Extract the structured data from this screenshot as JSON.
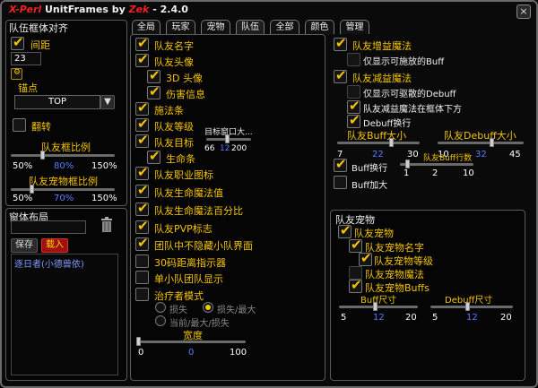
{
  "title": {
    "brand": "X-Perl",
    "rest": " UnitFrames by ",
    "author": "Zek",
    "version": " - 2.4.0"
  },
  "close_label": "×",
  "tabs": [
    "全局",
    "玩家",
    "宠物",
    "队伍",
    "全部",
    "颜色",
    "管理"
  ],
  "left": {
    "heading": "队伍框体对齐",
    "spacing_label": "间距",
    "spacing_value": "23",
    "anchor_label": "锚点",
    "anchor_value": "TOP",
    "flip_label": "翻转",
    "scale_label": "队友框比例",
    "scale_min": "50%",
    "scale_cur": "80%",
    "scale_max": "150%",
    "scale_fraction": 0.3,
    "pet_scale_label": "队友宠物框比例",
    "pet_scale_min": "50%",
    "pet_scale_cur": "70%",
    "pet_scale_max": "150%",
    "pet_scale_fraction": 0.2
  },
  "layout": {
    "label": "窗体布局",
    "save": "保存",
    "load": "载入",
    "list": [
      "逐日者(小德兽依)"
    ]
  },
  "mid": {
    "items": [
      {
        "label": "队友名字",
        "checked": true
      },
      {
        "label": "队友头像",
        "checked": true
      },
      {
        "label": "3D 头像",
        "checked": true
      },
      {
        "label": "伤害信息",
        "checked": true
      },
      {
        "label": "施法条",
        "checked": true
      },
      {
        "label": "队友等级",
        "checked": true
      },
      {
        "label": "队友目标",
        "checked": true
      },
      {
        "label": "生命条",
        "checked": true
      },
      {
        "label": "队友职业图标",
        "checked": true
      },
      {
        "label": "队友生命魔法值",
        "checked": true
      },
      {
        "label": "队友生命魔法百分比",
        "checked": true
      },
      {
        "label": "队友PVP标志",
        "checked": true
      },
      {
        "label": "团队中不隐藏小队界面",
        "checked": true
      },
      {
        "label": "30码距离指示器",
        "checked": false
      },
      {
        "label": "单小队团队显示",
        "checked": false
      },
      {
        "label": "治疗者模式",
        "checked": false
      }
    ],
    "target_window": {
      "label": "目标窗口大...",
      "min": "66",
      "cur": "12",
      "max": "200",
      "fraction": 0.45
    },
    "healer_options": {
      "loss": "损失",
      "loss_max": "损失/最大",
      "cur_max": "当前/最大/损失"
    },
    "width": {
      "label": "宽度",
      "min": "0",
      "cur": "0",
      "max": "100",
      "fraction": 0.0
    }
  },
  "right": {
    "buff_show": "队友增益魔法",
    "buff_castable": "仅显示可施放的Buff",
    "debuff_show": "队友减益魔法",
    "debuff_dispellable": "仅显示可驱散的Debuff",
    "debuff_in_frame": "队友减益魔法在框体下方",
    "debuff_wrap": "Debuff换行",
    "buff_size": {
      "label": "队友Buff大小",
      "min": "7",
      "cur": "22",
      "max": "30",
      "fraction": 0.65
    },
    "debuff_size": {
      "label": "队友Debuff大小",
      "min": "10",
      "cur": "32",
      "max": "45",
      "fraction": 0.62
    },
    "buff_wrap": "Buff换行",
    "buff_rows": {
      "label": "队友Buff行数",
      "min": "1",
      "cur": "2",
      "max": "10",
      "fraction": 0.1
    },
    "buff_big": "Buff加大",
    "pet": {
      "heading": "队友宠物",
      "show": "队友宠物",
      "name": "队友宠物名字",
      "level": "队友宠物等级",
      "debuffs_magic": "队友宠物魔法",
      "buffs": "队友宠物Buffs",
      "buff_size": {
        "label": "Buff尺寸",
        "min": "5",
        "cur": "12",
        "max": "20",
        "fraction": 0.45
      },
      "debuff_size": {
        "label": "Debuff尺寸",
        "min": "5",
        "cur": "12",
        "max": "20",
        "fraction": 0.45
      }
    }
  }
}
